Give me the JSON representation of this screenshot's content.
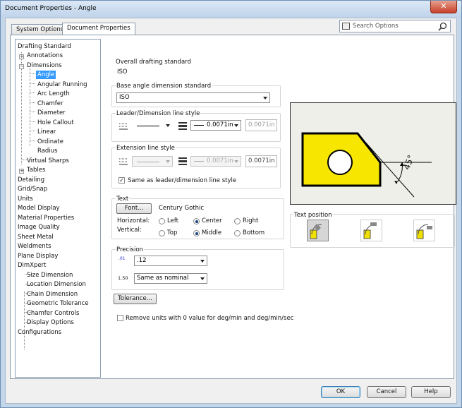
{
  "window": {
    "title": "Document Properties - Angle",
    "close_label": "✕"
  },
  "tabs": [
    {
      "label": "System Options"
    },
    {
      "label": "Document Properties"
    }
  ],
  "search": {
    "placeholder": "Search Options"
  },
  "tree": {
    "items": [
      {
        "label": "Drafting Standard"
      },
      {
        "label": "Annotations"
      },
      {
        "label": "Dimensions"
      },
      {
        "label": "Angle"
      },
      {
        "label": "Angular Running"
      },
      {
        "label": "Arc Length"
      },
      {
        "label": "Chamfer"
      },
      {
        "label": "Diameter"
      },
      {
        "label": "Hole Callout"
      },
      {
        "label": "Linear"
      },
      {
        "label": "Ordinate"
      },
      {
        "label": "Radius"
      },
      {
        "label": "Virtual Sharps"
      },
      {
        "label": "Tables"
      },
      {
        "label": "Detailing"
      },
      {
        "label": "Grid/Snap"
      },
      {
        "label": "Units"
      },
      {
        "label": "Model Display"
      },
      {
        "label": "Material Properties"
      },
      {
        "label": "Image Quality"
      },
      {
        "label": "Sheet Metal"
      },
      {
        "label": "Weldments"
      },
      {
        "label": "Plane Display"
      },
      {
        "label": "DimXpert"
      },
      {
        "label": "Size Dimension"
      },
      {
        "label": "Location Dimension"
      },
      {
        "label": "Chain Dimension"
      },
      {
        "label": "Geometric Tolerance"
      },
      {
        "label": "Chamfer Controls"
      },
      {
        "label": "Display Options"
      },
      {
        "label": "Configurations"
      }
    ]
  },
  "overall": {
    "label": "Overall drafting standard",
    "value": "ISO"
  },
  "base_angle": {
    "label": "Base angle dimension standard",
    "value": "ISO"
  },
  "leader_style": {
    "label": "Leader/Dimension line style",
    "thickness": "0.0071in",
    "custom": "0.0071in"
  },
  "extension_style": {
    "label": "Extension line style",
    "thickness": "0.0071in",
    "custom": "0.0071in",
    "same_as_label": "Same as leader/dimension line style",
    "same_as_checked": true
  },
  "text": {
    "label": "Text",
    "font_button": "Font...",
    "font_name": "Century Gothic",
    "horizontal_label": "Horizontal:",
    "vertical_label": "Vertical:",
    "h_left": "Left",
    "h_center": "Center",
    "h_right": "Right",
    "v_top": "Top",
    "v_middle": "Middle",
    "v_bottom": "Bottom",
    "h_selected": "Center",
    "v_selected": "Middle"
  },
  "text_position": {
    "label": "Text position"
  },
  "precision": {
    "label": "Precision",
    "primary": ".12",
    "tolerance": "Same as nominal",
    "icon1_text": ".01",
    "icon2_text": "1.50"
  },
  "tolerance_button": "Tolerance...",
  "remove_units": {
    "label": "Remove units with 0 value for deg/min and deg/min/sec",
    "checked": false
  },
  "preview": {
    "angle_label": "45°",
    "fill_color": "#f7e600"
  },
  "footer": {
    "ok": "OK",
    "cancel": "Cancel",
    "help": "Help"
  }
}
